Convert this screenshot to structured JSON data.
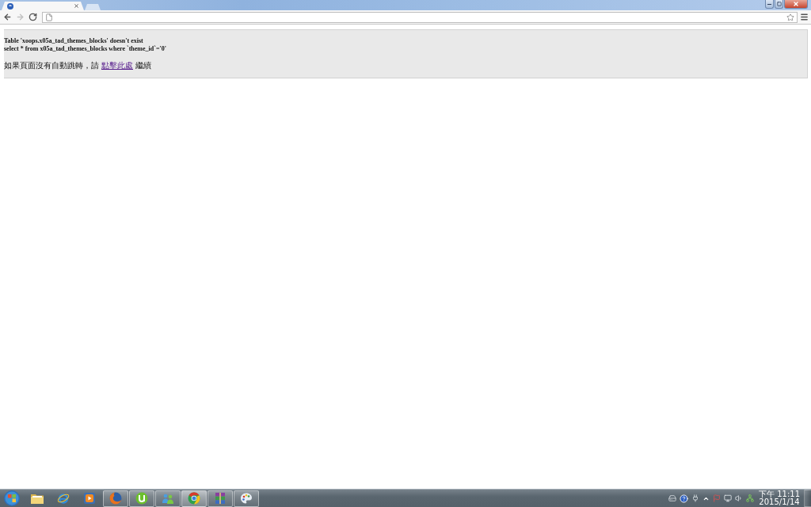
{
  "browser": {
    "tabs": [
      {
        "selected": true
      }
    ],
    "toolbar": {
      "back": {
        "disabled": false
      },
      "forward": {
        "disabled": true
      }
    }
  },
  "page": {
    "error_message": "Table 'xoops.x05a_tad_themes_blocks' doesn't exist",
    "sql_query": "select * from x05a_tad_themes_blocks where `theme_id`='0'",
    "redirect_notice": {
      "before": "如果頁面沒有自動跳轉，請",
      "link": "點擊此處",
      "after": "繼續"
    }
  },
  "taskbar": {
    "apps": [
      {
        "kind": "folder",
        "running": false,
        "selected": false
      },
      {
        "kind": "ie",
        "running": false,
        "selected": false
      },
      {
        "kind": "media",
        "running": false,
        "selected": false
      },
      {
        "kind": "firefox",
        "running": true,
        "selected": false
      },
      {
        "kind": "torrent",
        "running": true,
        "selected": false
      },
      {
        "kind": "people",
        "running": true,
        "selected": false
      },
      {
        "kind": "chrome",
        "running": true,
        "selected": true
      },
      {
        "kind": "archive",
        "running": true,
        "selected": false
      },
      {
        "kind": "paint",
        "running": true,
        "selected": false
      }
    ],
    "clock": {
      "time": "下午 11:11",
      "date": "2015/1/14"
    }
  }
}
